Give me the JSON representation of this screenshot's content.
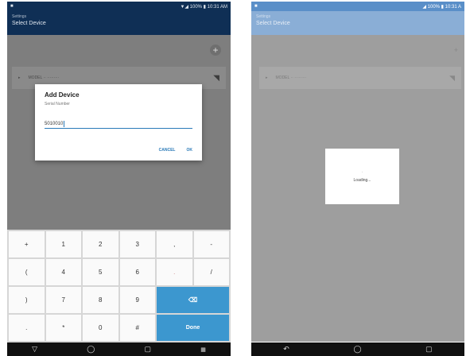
{
  "left": {
    "status": {
      "icon": "notification-icon",
      "text": "▼◢ 100% ▮ 10:31 AM"
    },
    "appbar": {
      "subtitle": "Settings",
      "title": "Select Device"
    },
    "add_glyph": "+",
    "device_row": {
      "expand": "▸",
      "text": "MODEL ·· ·········"
    },
    "dialog": {
      "title": "Add Device",
      "label": "Serial Number",
      "value": "5010010",
      "cancel": "CANCEL",
      "ok": "OK"
    },
    "keys": [
      "+",
      "1",
      "2",
      "3",
      ",",
      "-",
      "(",
      "4",
      "5",
      "6",
      ".",
      "/",
      ")",
      "7",
      "8",
      "9",
      "⌫",
      ".",
      "*",
      "0",
      "#",
      "Done"
    ],
    "nav": {
      "back": "▽",
      "home": "◯",
      "recents": "▢",
      "keyboard": "▦"
    }
  },
  "right": {
    "status": {
      "icon": "notification-icon",
      "text": "◢ 100% ▮ 10:31 A"
    },
    "appbar": {
      "subtitle": "Settings",
      "title": "Select Device"
    },
    "add_glyph": "+",
    "device_row": {
      "expand": "▸",
      "text": "MODEL ·· ·········"
    },
    "loading": {
      "spinner": "·",
      "text": "Loading..."
    },
    "nav": {
      "back": "↶",
      "home": "◯",
      "recents": "▢"
    }
  }
}
